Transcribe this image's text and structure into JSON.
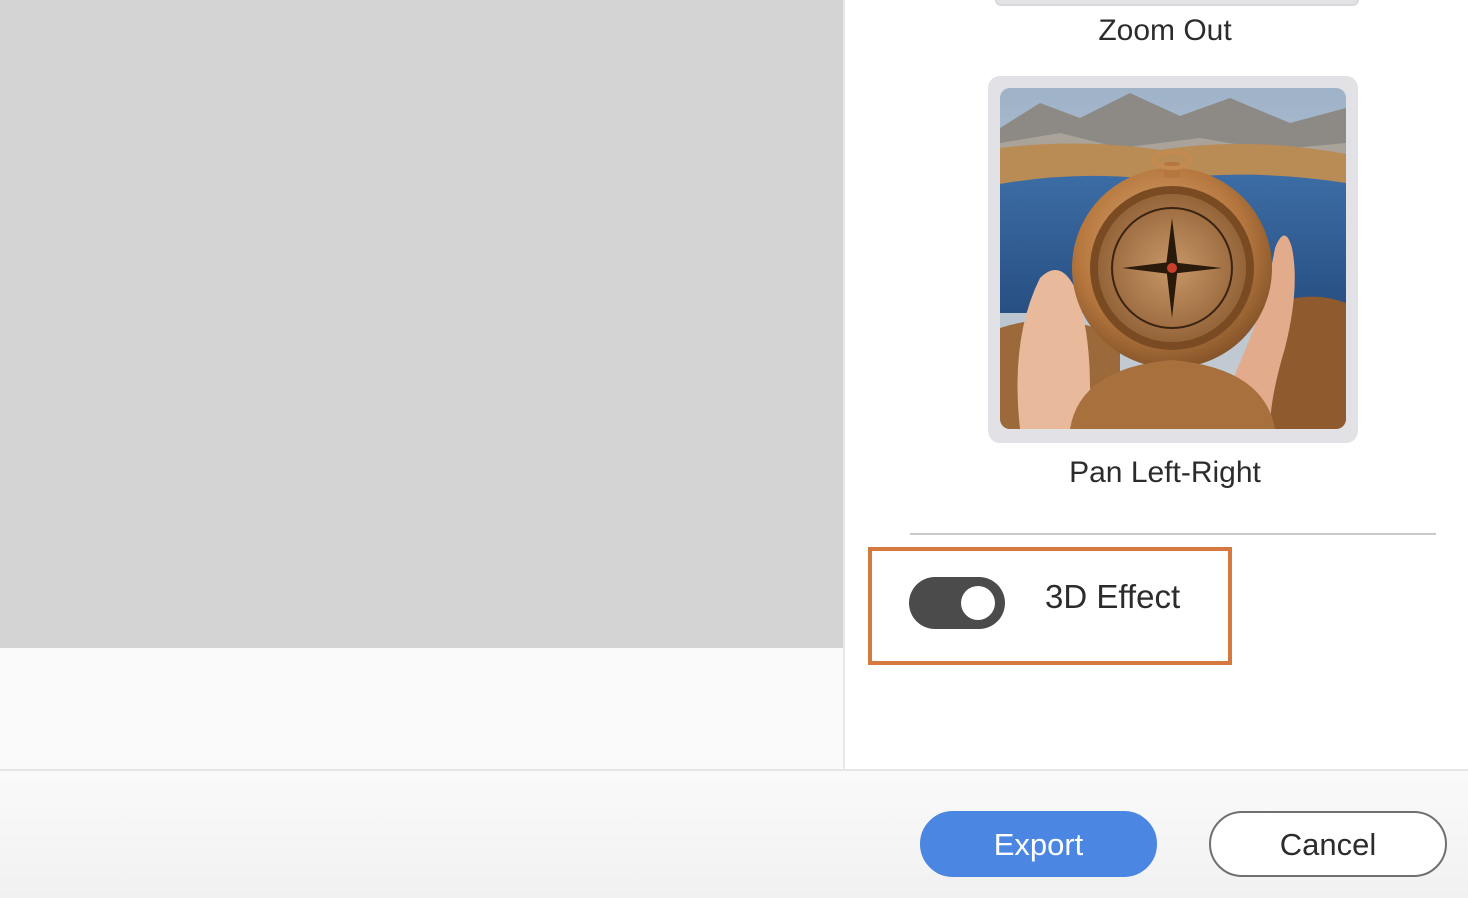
{
  "effects": [
    {
      "label": "Zoom Out"
    },
    {
      "label": "Pan Left-Right",
      "image": "compass-in-hand-lake-photo"
    }
  ],
  "options": {
    "three_d_effect": {
      "label": "3D Effect",
      "enabled": true
    }
  },
  "footer": {
    "export_label": "Export",
    "cancel_label": "Cancel"
  },
  "colors": {
    "preview_background": "#d4d4d4",
    "highlight": "#d6793f",
    "toggle_track": "#4b4b4b",
    "primary_button": "#4a86e2"
  }
}
